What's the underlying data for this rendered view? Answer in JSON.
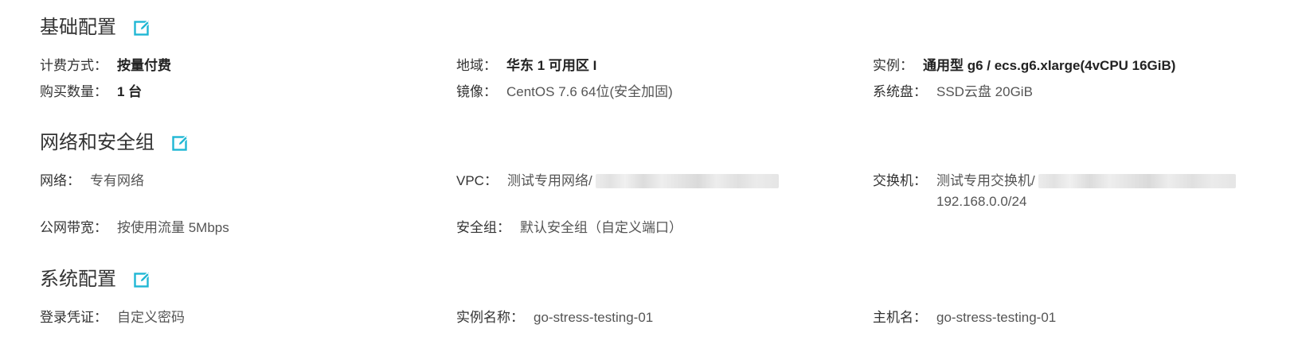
{
  "basic": {
    "title": "基础配置",
    "edit_icon": "edit-icon",
    "billing_label": "计费方式：",
    "billing_value": "按量付费",
    "region_label": "地域：",
    "region_value": "华东 1 可用区 I",
    "instance_label": "实例：",
    "instance_value": "通用型 g6 / ecs.g6.xlarge(4vCPU 16GiB)",
    "quantity_label": "购买数量：",
    "quantity_value": "1 台",
    "image_label": "镜像：",
    "image_value": "CentOS 7.6 64位(安全加固)",
    "disk_label": "系统盘：",
    "disk_value": "SSD云盘 20GiB"
  },
  "network": {
    "title": "网络和安全组",
    "edit_icon": "edit-icon",
    "network_label": "网络：",
    "network_value": "专有网络",
    "vpc_label": "VPC：",
    "vpc_value": "测试专用网络/",
    "switch_label": "交换机：",
    "switch_value": "测试专用交换机/",
    "switch_cidr": "192.168.0.0/24",
    "bandwidth_label": "公网带宽：",
    "bandwidth_value": "按使用流量 5Mbps",
    "security_group_label": "安全组：",
    "security_group_value": "默认安全组（自定义端口）"
  },
  "system": {
    "title": "系统配置",
    "edit_icon": "edit-icon",
    "login_label": "登录凭证：",
    "login_value": "自定义密码",
    "instance_name_label": "实例名称：",
    "instance_name_value": "go-stress-testing-01",
    "hostname_label": "主机名：",
    "hostname_value": "go-stress-testing-01"
  },
  "colors": {
    "accent": "#1fb7d4",
    "text": "#333333",
    "muted": "#555555"
  }
}
